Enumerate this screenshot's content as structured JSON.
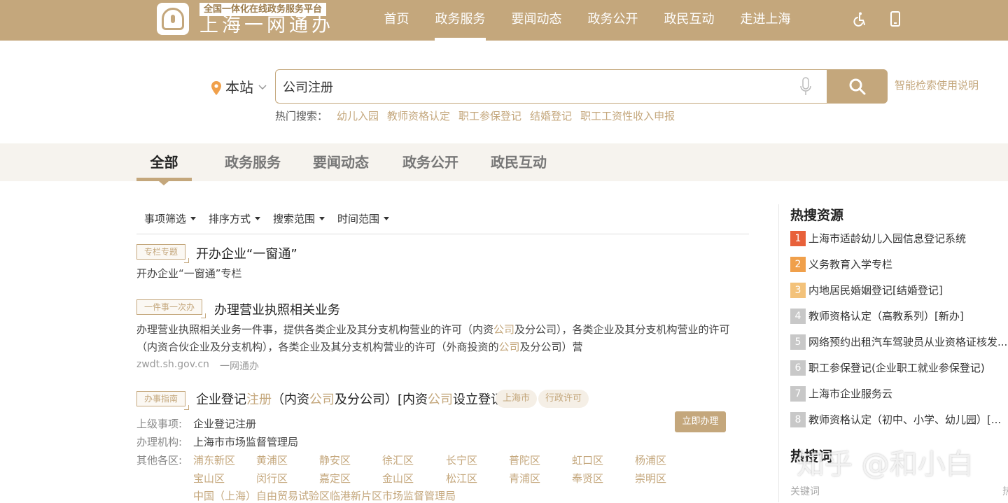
{
  "header": {
    "logo_sub": "全国一体化在线政务服务平台",
    "logo_title": "上海一网通办",
    "nav": [
      "首页",
      "政务服务",
      "要闻动态",
      "政务公开",
      "政民互动",
      "走进上海"
    ],
    "active_nav": "政务服务",
    "icons": [
      "accessibility-icon",
      "mobile-phone-icon"
    ]
  },
  "search": {
    "scope_label": "本站",
    "value": "公司注册",
    "help_link": "智能检索使用说明",
    "hot_label": "热门搜索：",
    "hot_keywords": [
      "幼儿入园",
      "教师资格认定",
      "职工参保登记",
      "结婚登记",
      "职工工资性收入申报"
    ]
  },
  "tabs": [
    "全部",
    "政务服务",
    "要闻动态",
    "政务公开",
    "政民互动"
  ],
  "active_tab": "全部",
  "filters": [
    "事项筛选",
    "排序方式",
    "搜索范围",
    "时间范围"
  ],
  "results": {
    "r1": {
      "tag": "专栏专题",
      "title": "开办企业“一窗通”",
      "desc": "开办企业“一窗通”专栏"
    },
    "r2": {
      "tag": "一件事一次办",
      "title": "办理营业执照相关业务",
      "desc1_a": "办理营业执照相关业务一件事，提供各类企业及其分支机构营业的许可（内资",
      "desc1_hl": "公司",
      "desc1_b": "及分公司），各类企业及其分支机构营业的许可",
      "desc2_a": "（内资合伙企业及分支机构），各类企业及其分支机构营业的许可（外商投资的",
      "desc2_hl": "公司",
      "desc2_b": "及分公司）营",
      "domain": "zwdt.sh.gov.cn",
      "source": "一网通办"
    },
    "r3": {
      "tag": "办事指南",
      "title_a": "企业登记",
      "title_hl1": "注册",
      "title_b": "（内资",
      "title_hl2": "公司",
      "title_c": "及分公司）[内资",
      "title_hl3": "公司",
      "title_d": "设立登记]",
      "pill1": "上海市",
      "pill2": "行政许可",
      "action": "立即办理",
      "parent_label": "上级事项:",
      "parent_value": "企业登记注册",
      "org_label": "办理机构:",
      "org_value": "上海市市场监督管理局",
      "districts_label": "其他各区:",
      "districts_row1": [
        "浦东新区",
        "黄浦区",
        "静安区",
        "徐汇区",
        "长宁区",
        "普陀区",
        "虹口区",
        "杨浦区"
      ],
      "districts_row2": [
        "宝山区",
        "闵行区",
        "嘉定区",
        "金山区",
        "松江区",
        "青浦区",
        "奉贤区",
        "崇明区"
      ],
      "districts_extra": "中国（上海）自由贸易试验区临港新片区市场监督管理局"
    }
  },
  "sidebar": {
    "hot_title": "热搜资源",
    "hot_items": [
      {
        "num": "1",
        "text": "上海市适龄幼儿入园信息登记系统",
        "color": "#e8613a"
      },
      {
        "num": "2",
        "text": "义务教育入学专栏",
        "color": "#f0a04b"
      },
      {
        "num": "3",
        "text": "内地居民婚姻登记[结婚登记]",
        "color": "#f3c27a"
      },
      {
        "num": "4",
        "text": "教师资格认定（高教系列）[新办]",
        "color": "#c8c8c8"
      },
      {
        "num": "5",
        "text": "网络预约出租汽车驾驶员从业资格证核发...",
        "color": "#c8c8c8"
      },
      {
        "num": "6",
        "text": "职工参保登记(企业职工就业参保登记)",
        "color": "#c8c8c8"
      },
      {
        "num": "7",
        "text": "上海市企业服务云",
        "color": "#c8c8c8"
      },
      {
        "num": "8",
        "text": "教师资格认定（初中、小学、幼儿园）[...",
        "color": "#c8c8c8"
      }
    ],
    "hot2_title": "热搜词",
    "kw_label": "关键词",
    "kw_right": "热"
  },
  "watermark": "知乎 @和小白",
  "colors": {
    "brand": "#c4a77c",
    "tab_bg": "#f6f3ee"
  }
}
